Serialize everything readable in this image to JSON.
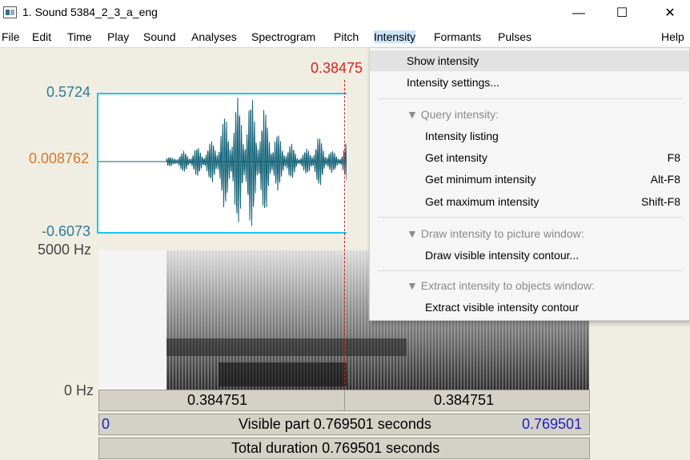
{
  "window": {
    "title": "1. Sound 5384_2_3_a_eng",
    "minimize": "—",
    "maximize": "☐",
    "close": "✕"
  },
  "menubar": [
    {
      "name": "menu-file",
      "label": "File"
    },
    {
      "name": "menu-edit",
      "label": "Edit"
    },
    {
      "name": "menu-time",
      "label": "Time"
    },
    {
      "name": "menu-play",
      "label": "Play"
    },
    {
      "name": "menu-sound",
      "label": "Sound"
    },
    {
      "name": "menu-analyses",
      "label": "Analyses"
    },
    {
      "name": "menu-spectrogram",
      "label": "Spectrogram"
    },
    {
      "name": "menu-pitch",
      "label": "Pitch"
    },
    {
      "name": "menu-intensity",
      "label": "Intensity"
    },
    {
      "name": "menu-formants",
      "label": "Formants"
    },
    {
      "name": "menu-pulses",
      "label": "Pulses"
    },
    {
      "name": "menu-help",
      "label": "Help"
    }
  ],
  "editor": {
    "cursor_time": "0.38475",
    "wave_max": "0.5724",
    "wave_zero": "0.008762",
    "wave_min": "-0.6073",
    "spec_top": "5000 Hz",
    "spec_bottom": "0 Hz",
    "sel_left": "0.384751",
    "sel_right": "0.384751",
    "visible_start": "0",
    "visible_label": "Visible part 0.769501 seconds",
    "visible_end": "0.769501",
    "total_label": "Total duration 0.769501 seconds"
  },
  "intensity_menu": {
    "show_intensity": "Show intensity",
    "intensity_settings": "Intensity settings...",
    "query_header": "▼ Query intensity:",
    "intensity_listing": "Intensity listing",
    "get_intensity": "Get intensity",
    "get_intensity_sc": "F8",
    "get_min": "Get minimum intensity",
    "get_min_sc": "Alt-F8",
    "get_max": "Get maximum intensity",
    "get_max_sc": "Shift-F8",
    "draw_header": "▼ Draw intensity to picture window:",
    "draw_contour": "Draw visible intensity contour...",
    "extract_header": "▼ Extract intensity to objects window:",
    "extract_contour": "Extract visible intensity contour"
  },
  "colors": {
    "waveform": "#0e5f75",
    "cursor": "#e02020",
    "selection_frame": "#18c6f0",
    "axis_labels": "#2e7a99",
    "zero_label": "#d27a2a",
    "range_labels": "#2020c8"
  }
}
